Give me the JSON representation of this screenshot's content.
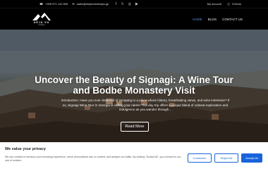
{
  "topbar": {
    "phone": "+995 571 142 506",
    "email": "sales@dejavuholidays.ge",
    "social_icons": [
      "facebook-icon",
      "x-icon",
      "instagram-icon",
      "youtube-icon"
    ],
    "account_label": "My account",
    "cart_label": "0 items"
  },
  "nav": {
    "logo_brand": "DEJA VU",
    "logo_sub": "holidays",
    "links": [
      {
        "label": "HOME",
        "active": true
      },
      {
        "label": "BLOG",
        "active": false
      },
      {
        "label": "CONTACT US",
        "active": false
      }
    ]
  },
  "hero": {
    "title": "Uncover the Beauty of Signagi: A Wine Tour and Bodbe Monastery Visit",
    "text": "Introduction: Have you ever dreamed of escaping to a place where history, breathtaking views, and wine intertwine? If so, Signagi Wine Tour in Georgia is calling your name! This day trip offers a unique blend of cultural exploration and indulgence as you wander through...",
    "button": "Read More"
  },
  "cookie": {
    "title": "We value your privacy",
    "text": "We use cookies to enhance your browsing experience, serve personalized ads or content, and analyze our traffic. By clicking \"Accept All\", you consent to our use of cookies.",
    "customize": "Customize",
    "reject": "Reject All",
    "accept": "Accept All"
  },
  "colors": {
    "accent": "#1863dc",
    "nav_active": "#5a8fd8"
  }
}
